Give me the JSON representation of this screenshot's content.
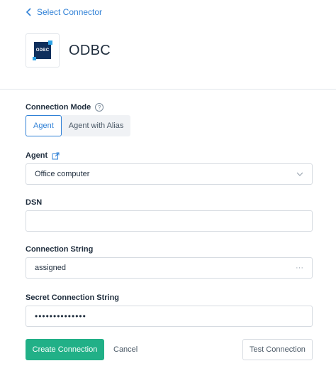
{
  "nav": {
    "back_label": "Select Connector"
  },
  "header": {
    "logo_text": "ODBC",
    "title": "ODBC"
  },
  "connection_mode": {
    "label": "Connection Mode",
    "help": "?",
    "options": [
      "Agent",
      "Agent with Alias"
    ],
    "selected": "Agent"
  },
  "agent": {
    "label": "Agent",
    "value": "Office computer"
  },
  "dsn": {
    "label": "DSN",
    "value": ""
  },
  "connection_string": {
    "label": "Connection String",
    "value": "assigned",
    "more": "···"
  },
  "secret_connection_string": {
    "label": "Secret Connection String",
    "value": "••••••••••••••"
  },
  "actions": {
    "create_label": "Create Connection",
    "cancel_label": "Cancel",
    "test_label": "Test Connection"
  },
  "colors": {
    "accent": "#2f80d6",
    "primary_button": "#21b087",
    "logo": "#0f2f5c"
  }
}
